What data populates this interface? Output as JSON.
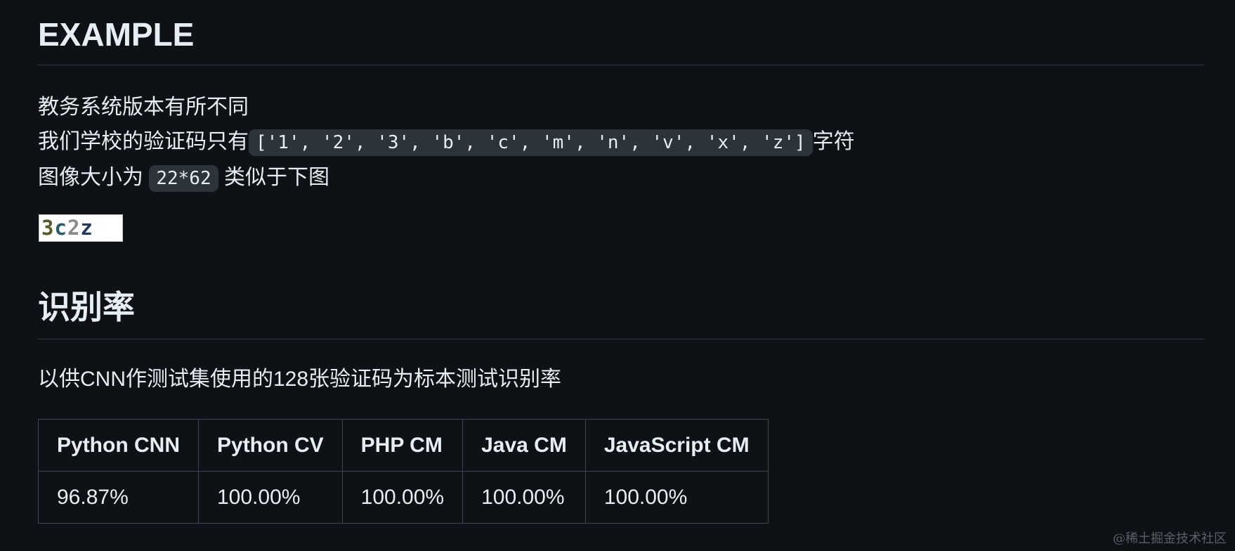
{
  "section1": {
    "title": "EXAMPLE",
    "line1": "教务系统版本有所不同",
    "line2_prefix": "我们学校的验证码只有",
    "line2_code": "['1', '2', '3', 'b', 'c', 'm', 'n', 'v', 'x', 'z']",
    "line2_suffix": "字符",
    "line3_prefix": "图像大小为",
    "line3_code": "22*62",
    "line3_suffix": "类似于下图",
    "captcha": [
      "3",
      "c",
      "2",
      "z"
    ]
  },
  "section2": {
    "title": "识别率",
    "description": "以供CNN作测试集使用的128张验证码为标本测试识别率"
  },
  "table": {
    "headers": [
      "Python CNN",
      "Python CV",
      "PHP CM",
      "Java CM",
      "JavaScript CM"
    ],
    "rows": [
      [
        "96.87%",
        "100.00%",
        "100.00%",
        "100.00%",
        "100.00%"
      ]
    ]
  },
  "watermark": "@稀土掘金技术社区"
}
